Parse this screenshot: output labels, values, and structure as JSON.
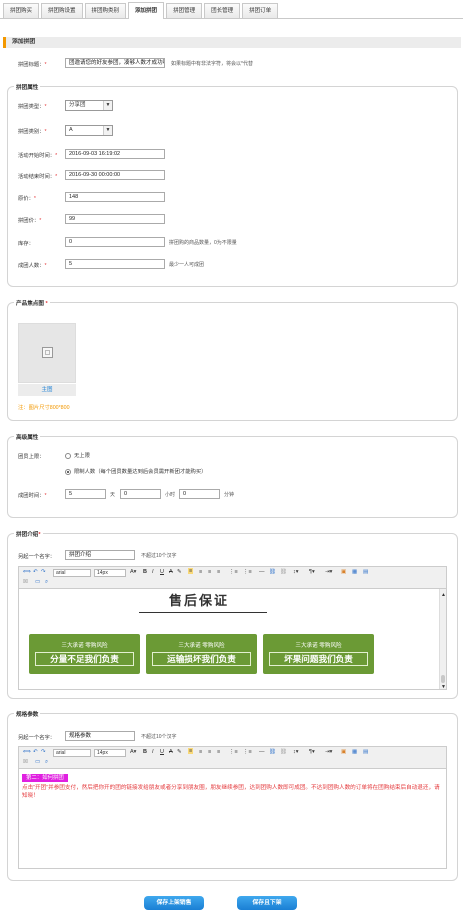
{
  "tabs": [
    "拼团购买",
    "拼团购设置",
    "拼团购类别",
    "添加拼团",
    "拼团管理",
    "团长管理",
    "拼团订单"
  ],
  "section_title": "添加拼团",
  "title_field": {
    "label": "拼团标题：",
    "value": "团邀请您的好友参团，凑够人数才成功哦！",
    "hint": "如果标题中有非法字符，将会以*代替"
  },
  "props": {
    "legend": "拼团属性",
    "type_label": "拼团类型：",
    "type_value": "分享团",
    "category_label": "拼团类别：",
    "category_value": "A",
    "start_label": "活动开始时间：",
    "start_value": "2016-09-03 16:19:02",
    "end_label": "活动结束时间：",
    "end_value": "2016-09-30 00:00:00",
    "orig_label": "原价：",
    "orig_value": "148",
    "price_label": "拼团价：",
    "price_value": "99",
    "stock_label": "库存：",
    "stock_value": "0",
    "stock_hint": "拼团购的商品数量，0为不限量",
    "members_label": "成团人数：",
    "members_value": "5",
    "members_hint": "最少一人可成团"
  },
  "product": {
    "legend": "产品焦点图",
    "main_label": "主图",
    "note": "注：图片尺寸800*800"
  },
  "advanced": {
    "legend": "高级属性",
    "limit_label": "团员上限：",
    "opt_unlimited": "无上限",
    "opt_limited": "限制人数（每个团员数量达到后会员需开新团才能购买）",
    "time_label": "成团时间：",
    "days": "5",
    "days_unit": "天",
    "hours": "0",
    "hours_unit": "小时",
    "minutes": "0",
    "minutes_unit": "分钟"
  },
  "intro": {
    "legend": "拼团介绍",
    "alias_label": "另起一个名字：",
    "alias_value": "拼团介绍",
    "alias_hint": "不超过10个汉字",
    "font": "arial",
    "size": "14px",
    "content_title": "售后保证",
    "banners": [
      {
        "top": "三大承诺 零购风险",
        "big": "分量不足我们负责"
      },
      {
        "top": "三大承诺 零购风险",
        "big": "运输损坏我们负责"
      },
      {
        "top": "三大承诺 零购风险",
        "big": "坏果问题我们负责"
      }
    ]
  },
  "spec": {
    "legend": "规格参数",
    "alias_label": "另起一个名字：",
    "alias_value": "规格参数",
    "alias_hint": "不超过10个汉字",
    "font": "arial",
    "size": "14px",
    "tag": "第二：如何拼团",
    "text": "点击“开团”并参团支付，然后把你开的团的链接发给朋友或者分享到朋友圈，朋友继续参团，达到团购人数即可成团。不达到团购人数的订单将在团购结束后自动退还，请知晓！"
  },
  "buttons": {
    "save_on": "保存上架销售",
    "save_off": "保存且下架"
  },
  "colors": {
    "accent": "#f39800",
    "button": "#1a7fd4",
    "banner": "#6b9a35",
    "warn": "#e4393c"
  }
}
